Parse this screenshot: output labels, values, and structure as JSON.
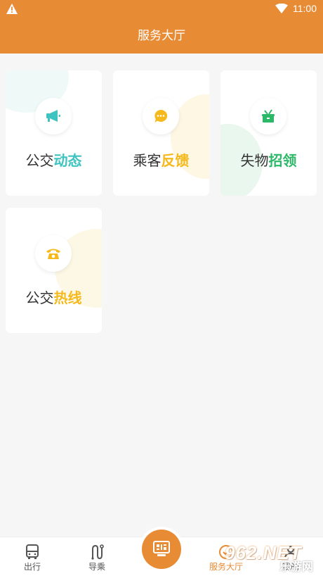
{
  "status_bar": {
    "time": "11:00",
    "warning_icon": "warning-triangle-icon",
    "wifi_icon": "wifi-icon"
  },
  "header": {
    "title": "服务大厅"
  },
  "cards": [
    {
      "prefix": "公交",
      "highlight": "动态",
      "icon": "megaphone-icon",
      "color": "#3ec3c0"
    },
    {
      "prefix": "乘客",
      "highlight": "反馈",
      "icon": "chat-bubble-icon",
      "color": "#f5b91c"
    },
    {
      "prefix": "失物",
      "highlight": "招领",
      "icon": "gift-box-icon",
      "color": "#2bb968"
    },
    {
      "prefix": "公交",
      "highlight": "热线",
      "icon": "telephone-icon",
      "color": "#f5b91c"
    }
  ],
  "tabbar": {
    "tabs": [
      {
        "label": "出行",
        "icon": "bus-icon"
      },
      {
        "label": "导乘",
        "icon": "route-icon"
      },
      {
        "label": "服务大厅",
        "icon": "service-icon",
        "active": true
      },
      {
        "label": "我的",
        "icon": "user-icon"
      }
    ],
    "scan_icon": "qr-scan-icon"
  },
  "watermark": {
    "brand": "962.NET",
    "sub": "乐游网"
  },
  "colors": {
    "primary": "#e88b35",
    "background": "#f6f6f6"
  }
}
